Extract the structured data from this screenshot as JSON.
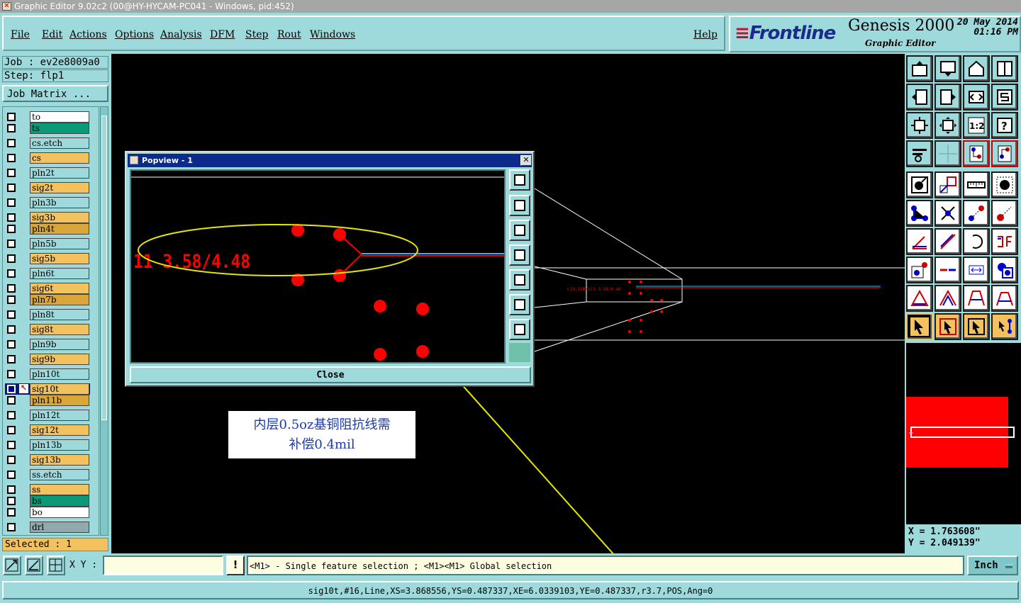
{
  "window": {
    "title": "Graphic Editor 9.02c2 (00@HY-HYCAM-PC041 - Windows, pid:452)"
  },
  "menu": {
    "items": [
      "File",
      "Edit",
      "Actions",
      "Options",
      "Analysis",
      "DFM",
      "Step",
      "Rout",
      "Windows"
    ],
    "help": "Help"
  },
  "brand": {
    "logo": "Frontline",
    "product": "Genesis 2000",
    "subtitle": "Graphic Editor",
    "date": "20 May 2014",
    "time": "01:16 PM"
  },
  "job": {
    "job_line": "Job : ev2e8009a0",
    "step_line": "Step: flp1",
    "matrix_button": "Job Matrix ..."
  },
  "layers": [
    {
      "name": "to",
      "color": "#ffffff"
    },
    {
      "name": "ts",
      "color": "#0a9a7a"
    },
    {
      "name": "cs.etch",
      "color": "#9ed9dc"
    },
    {
      "name": "cs",
      "color": "#f3c15d"
    },
    {
      "name": "pln2t",
      "color": "#9ed9dc"
    },
    {
      "name": "sig2t",
      "color": "#f3c15d"
    },
    {
      "name": "pln3b",
      "color": "#9ed9dc"
    },
    {
      "name": "sig3b",
      "color": "#f3c15d"
    },
    {
      "name": "pln4t",
      "color": "#d9a63a"
    },
    {
      "name": "pln5b",
      "color": "#9ed9dc"
    },
    {
      "name": "sig5b",
      "color": "#f3c15d"
    },
    {
      "name": "pln6t",
      "color": "#9ed9dc"
    },
    {
      "name": "sig6t",
      "color": "#f3c15d"
    },
    {
      "name": "pln7b",
      "color": "#d9a63a"
    },
    {
      "name": "pln8t",
      "color": "#9ed9dc"
    },
    {
      "name": "sig8t",
      "color": "#f3c15d"
    },
    {
      "name": "pln9b",
      "color": "#9ed9dc"
    },
    {
      "name": "sig9b",
      "color": "#f3c15d"
    },
    {
      "name": "pln10t",
      "color": "#9ed9dc"
    },
    {
      "name": "sig10t",
      "color": "#f3c15d",
      "selected": true
    },
    {
      "name": "pln11b",
      "color": "#d9a63a"
    },
    {
      "name": "pln12t",
      "color": "#9ed9dc"
    },
    {
      "name": "sig12t",
      "color": "#f3c15d"
    },
    {
      "name": "pln13b",
      "color": "#9ed9dc"
    },
    {
      "name": "sig13b",
      "color": "#f3c15d"
    },
    {
      "name": "ss.etch",
      "color": "#9ed9dc"
    },
    {
      "name": "ss",
      "color": "#f3c15d"
    },
    {
      "name": "bs",
      "color": "#0a9a7a"
    },
    {
      "name": "bo",
      "color": "#ffffff"
    },
    {
      "name": "drl",
      "color": "#8fa9ac"
    }
  ],
  "selection": {
    "text": "Selected : 1"
  },
  "popview": {
    "title": "Popview - 1",
    "close_label": "Close",
    "close_glyph": "✕",
    "label_text": "11 3.58/4.48"
  },
  "canvas": {
    "small_label": "L10,11B/LC1 3.58/4.48"
  },
  "annotation": {
    "line1": "内层0.5oz基铜阻抗线需",
    "line2": "补偿0.4mil"
  },
  "coords": {
    "x": "X = 1.763608\"",
    "y": "Y = 2.049139\""
  },
  "bottom": {
    "xy_label": "X Y :",
    "xy_value": "",
    "warn": "!",
    "hint": "<M1> - Single feature selection ; <M1><M1> Global selection",
    "unit": "Inch"
  },
  "status": {
    "text": "sig10t,#16,Line,XS=3.868556,YS=0.487337,XE=6.0339103,YE=0.487337,r3.7,POS,Ang=0"
  },
  "colors": {
    "panel": "#9ed9dc",
    "orange": "#f3c15d",
    "title_blue": "#0b2a8c",
    "feature_red": "#ff0000",
    "annotation_yellow": "#e6e600"
  }
}
